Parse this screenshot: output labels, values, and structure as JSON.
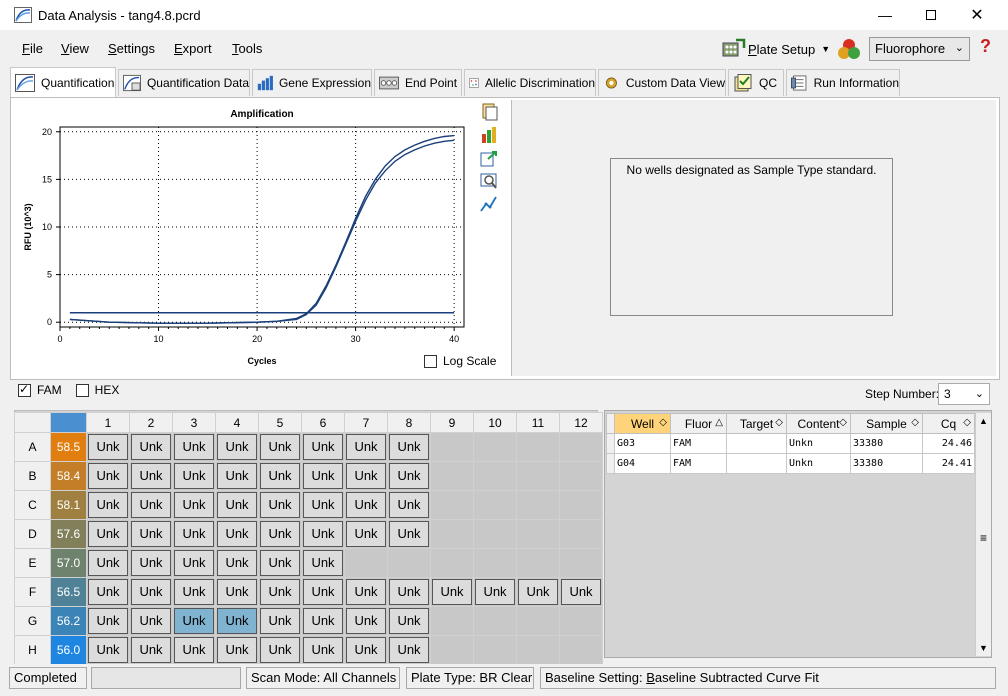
{
  "window": {
    "title": "Data Analysis - tang4.8.pcrd"
  },
  "menu": {
    "file": {
      "pre": "",
      "key": "F",
      "post": "ile"
    },
    "view": {
      "pre": "",
      "key": "V",
      "post": "iew"
    },
    "settings": {
      "pre": "",
      "key": "S",
      "post": "ettings"
    },
    "export": {
      "pre": "",
      "key": "E",
      "post": "xport"
    },
    "tools": {
      "pre": "",
      "key": "T",
      "post": "ools"
    },
    "plate_setup": {
      "pre": "",
      "key": "P",
      "post": "late Setup"
    },
    "fluorophore": "Fluorophore"
  },
  "tabs": [
    "Quantification",
    "Quantification Data",
    "Gene Expression",
    "End Point",
    "Allelic Discrimination",
    "Custom Data View",
    "QC",
    "Run Information"
  ],
  "chart_data": {
    "type": "line",
    "title": "Amplification",
    "xlabel": "Cycles",
    "ylabel": "RFU (10^3)",
    "xlim": [
      0,
      41
    ],
    "ylim": [
      -0.5,
      20.5
    ],
    "xticks": [
      0,
      10,
      20,
      30,
      40
    ],
    "yticks": [
      0,
      5,
      10,
      15,
      20
    ],
    "grid": true,
    "series": [
      {
        "values_x": [
          1,
          5,
          10,
          15,
          20,
          22,
          24,
          25,
          26,
          27,
          28,
          29,
          30,
          31,
          32,
          33,
          34,
          35,
          36,
          37,
          38,
          39,
          40
        ],
        "values_y": [
          0.3,
          0.0,
          -0.1,
          -0.1,
          0.0,
          0.1,
          0.4,
          0.9,
          2.0,
          3.8,
          6.0,
          8.4,
          10.9,
          13.2,
          15.0,
          16.4,
          17.4,
          18.1,
          18.6,
          19.0,
          19.3,
          19.5,
          19.6
        ]
      },
      {
        "values_x": [
          1,
          5,
          10,
          15,
          20,
          22,
          24,
          25,
          26,
          27,
          28,
          29,
          30,
          31,
          32,
          33,
          34,
          35,
          36,
          37,
          38,
          39,
          40
        ],
        "values_y": [
          0.3,
          0.0,
          -0.1,
          -0.1,
          0.0,
          0.1,
          0.3,
          0.8,
          1.8,
          3.6,
          5.8,
          8.2,
          10.6,
          12.8,
          14.6,
          15.9,
          16.9,
          17.6,
          18.1,
          18.5,
          18.8,
          19.0,
          19.1
        ]
      }
    ],
    "threshold": 1.0
  },
  "log_scale_label": "Log Scale",
  "std_message": "No wells designated as Sample Type standard.",
  "fluors": [
    {
      "label": "FAM",
      "checked": true
    },
    {
      "label": "HEX",
      "checked": false
    }
  ],
  "step": {
    "label": "Step Number:",
    "value": "3"
  },
  "plate": {
    "columns": [
      "1",
      "2",
      "3",
      "4",
      "5",
      "6",
      "7",
      "8",
      "9",
      "10",
      "11",
      "12"
    ],
    "rows": [
      {
        "label": "A",
        "temp": "58.5",
        "color": "#e07f10",
        "wells": 8
      },
      {
        "label": "B",
        "temp": "58.4",
        "color": "#c47e28",
        "wells": 8
      },
      {
        "label": "C",
        "temp": "58.1",
        "color": "#a08040",
        "wells": 8
      },
      {
        "label": "D",
        "temp": "57.6",
        "color": "#82805a",
        "wells": 8
      },
      {
        "label": "E",
        "temp": "57.0",
        "color": "#6e826e",
        "wells": 6
      },
      {
        "label": "F",
        "temp": "56.5",
        "color": "#4f8296",
        "wells": 12
      },
      {
        "label": "G",
        "temp": "56.2",
        "color": "#3a84b8",
        "wells": 8
      },
      {
        "label": "H",
        "temp": "56.0",
        "color": "#1e86e0",
        "wells": 8
      }
    ],
    "well_label": "Unk",
    "selected": [
      "G3",
      "G4"
    ]
  },
  "grid": {
    "headers": [
      "Well",
      "Fluor",
      "Target",
      "Content",
      "Sample",
      "Cq"
    ],
    "rows": [
      {
        "well": "G03",
        "fluor": "FAM",
        "target": "",
        "content": "Unkn",
        "sample": "33380",
        "cq": "24.46"
      },
      {
        "well": "G04",
        "fluor": "FAM",
        "target": "",
        "content": "Unkn",
        "sample": "33380",
        "cq": "24.41"
      }
    ]
  },
  "status": {
    "state": "Completed",
    "scan_mode": "Scan Mode: All Channels",
    "plate_type": "Plate Type: BR Clear",
    "baseline": {
      "pre": "Baseline Setting: ",
      "key": "B",
      "post": "aseline Subtracted Curve Fit"
    }
  }
}
